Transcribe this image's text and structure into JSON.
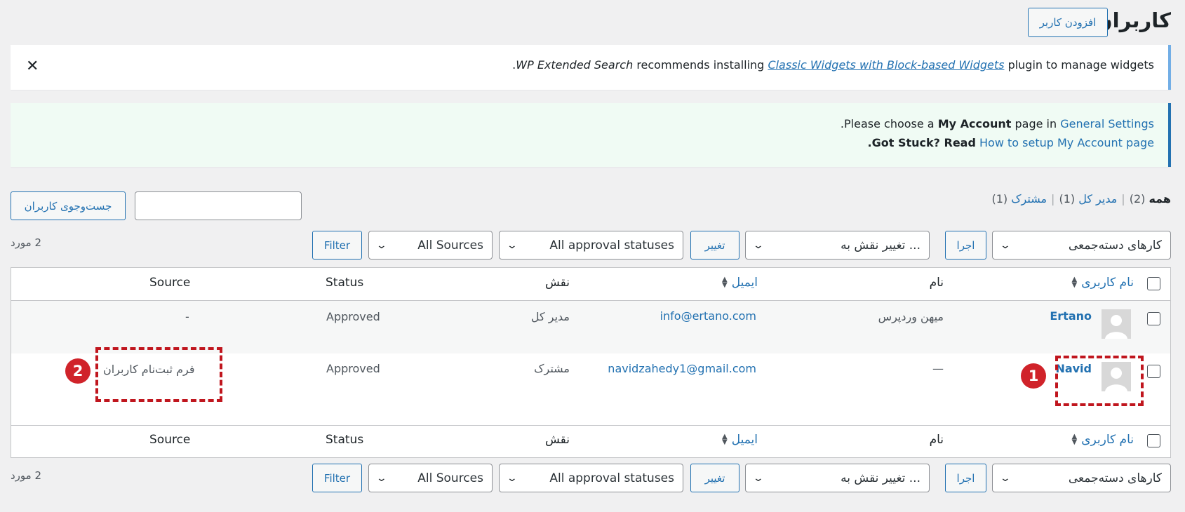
{
  "header": {
    "title": "کاربران",
    "add_user": "افزودن کاربر"
  },
  "notice_widgets": {
    "suffix": "plugin to manage widgets",
    "link": "Classic Widgets with Block-based Widgets",
    "middle": "recommends installing",
    "plugin": "WP Extended Search",
    "dot": "."
  },
  "notice_account": {
    "line1_link": "General Settings",
    "line1_mid": "page in",
    "line1_bold": "My Account",
    "line1_pre": "Please choose a",
    "line1_dot": ".",
    "line2_link": "How to setup My Account page",
    "line2_bold": "Got Stuck? Read",
    "line2_dot": "."
  },
  "views": {
    "all": "همه",
    "all_count": "(2)",
    "admin": "مدیر کل",
    "admin_count": "(1)",
    "subscriber": "مشترک",
    "subscriber_count": "(1)"
  },
  "search": {
    "button": "جست‌وجوی کاربران",
    "value": ""
  },
  "tablenav": {
    "bulk": "کارهای دسته‌جمعی",
    "apply": "اجرا",
    "role": "تغییر نقش به ...",
    "change": "تغییر",
    "approval": "All approval statuses",
    "sources": "All Sources",
    "filter": "Filter",
    "count": "2 مورد"
  },
  "columns": {
    "username": "نام کاربری",
    "name": "نام",
    "email": "ایمیل",
    "role": "نقش",
    "status": "Status",
    "source": "Source"
  },
  "rows": [
    {
      "username": "Ertano",
      "name": "میهن وردپرس",
      "email": "info@ertano.com",
      "role": "مدیر کل",
      "status": "Approved",
      "source": "-"
    },
    {
      "username": "Navid",
      "name": "—",
      "email": "navidzahedy1@gmail.com",
      "role": "مشترک",
      "status": "Approved",
      "source": "فرم ثبت‌نام کاربران"
    }
  ],
  "annotations": {
    "one": "1",
    "two": "2"
  },
  "colors": {
    "accent": "#2271b1",
    "annotation": "#c0161e",
    "notice_bg": "#f0fbf4"
  }
}
